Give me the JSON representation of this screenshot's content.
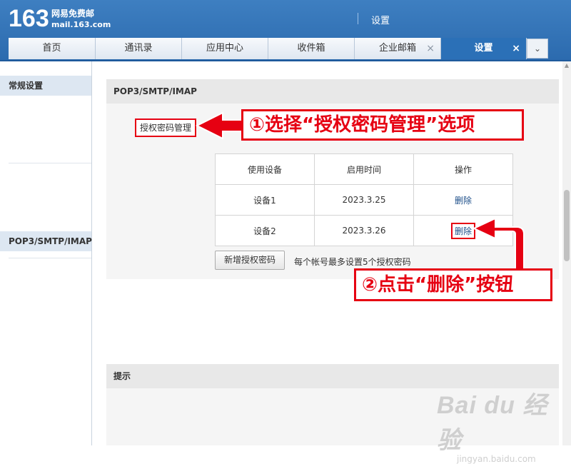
{
  "header": {
    "logo_number": "163",
    "logo_brand": "网易免费邮",
    "logo_domain": "mail.163.com",
    "page_title": "设置"
  },
  "tabs": [
    {
      "label": "首页"
    },
    {
      "label": "通讯录"
    },
    {
      "label": "应用中心"
    },
    {
      "label": "收件箱"
    },
    {
      "label": "企业邮箱",
      "close": "×"
    },
    {
      "label": "设置",
      "close": "×",
      "active": true
    }
  ],
  "tab_dropdown": "⌄",
  "sidebar": {
    "items": [
      {
        "label": "常规设置"
      },
      {
        "label": "POP3/SMTP/IMAP"
      }
    ]
  },
  "section": {
    "title": "POP3/SMTP/IMAP",
    "auth_link": "授权密码管理",
    "devices_table": {
      "headers": [
        "使用设备",
        "启用时间",
        "操作"
      ],
      "rows": [
        {
          "device": "设备1",
          "time": "2023.3.25",
          "action": "删除"
        },
        {
          "device": "设备2",
          "time": "2023.3.26",
          "action": "删除"
        }
      ]
    },
    "add_button": "新增授权密码",
    "add_note": "每个帐号最多设置5个授权密码"
  },
  "tips": {
    "title": "提示"
  },
  "annotations": {
    "step1": "①选择“授权密码管理”选项",
    "step2": "②点击“删除”按钮",
    "color": "#e60012"
  },
  "watermark": {
    "brand": "Bai du 经验",
    "url": "jingyan.baidu.com"
  },
  "colors": {
    "header_blue": "#2b6aae",
    "active_tab": "#2b70b7",
    "link": "#1d4e89"
  }
}
